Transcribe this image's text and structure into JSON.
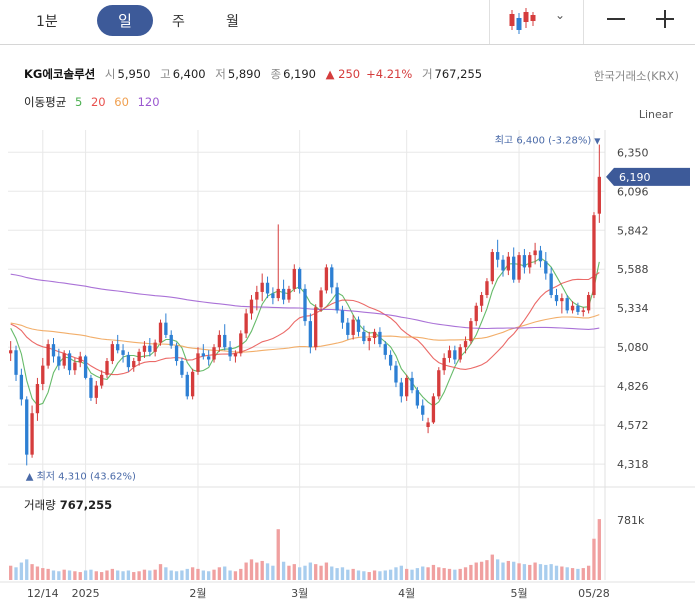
{
  "toolbar": {
    "timeframes": [
      "1분",
      "일",
      "주",
      "월"
    ],
    "active": "일",
    "icons": [
      "candlestick-chart-icon",
      "chevron-down-icon",
      "zoom-out-icon",
      "zoom-in-icon"
    ]
  },
  "stock": {
    "name": "KG에코솔루션",
    "open_label": "시",
    "open": "5,950",
    "high_label": "고",
    "high": "6,400",
    "low_label": "저",
    "low": "5,890",
    "close_label": "종",
    "close": "6,190",
    "change": "▲ 250",
    "change_pct": "+4.21%",
    "volume_label": "거",
    "volume": "767,255",
    "exchange": "한국거래소(KRX)"
  },
  "ma_legend": {
    "label": "이동평균",
    "periods": [
      {
        "text": "5",
        "color": "#4caf50"
      },
      {
        "text": "20",
        "color": "#e8504d"
      },
      {
        "text": "60",
        "color": "#f0a050"
      },
      {
        "text": "120",
        "color": "#9b59d0"
      }
    ]
  },
  "scale_mode": "Linear",
  "volume_panel": {
    "title": "거래량",
    "value": "767,255",
    "axis_label": "781k"
  },
  "colors": {
    "up": "#d53c3c",
    "down": "#2d7fd3",
    "volume_up": "#f0a0a0",
    "volume_down": "#a8cdee",
    "price_tag": "#3d5a99",
    "grid": "#e8e8e8"
  },
  "chart_data": {
    "type": "candlestick",
    "y_ticks": [
      "6,350",
      "6,096",
      "5,842",
      "5,588",
      "5,334",
      "5,080",
      "4,826",
      "4,572",
      "4,318"
    ],
    "x_ticks": [
      "12/14",
      "2025",
      "2월",
      "3월",
      "4월",
      "5월",
      "05/28"
    ],
    "ylim": [
      4280,
      6430
    ],
    "current_price": "6,190",
    "max_annotation": "최고 6,400 (-3.28%)",
    "min_annotation": "최저 4,310 (43.62%)",
    "candles": [
      [
        5040,
        5120,
        4990,
        5060
      ],
      [
        5060,
        5090,
        4860,
        4900
      ],
      [
        4900,
        4940,
        4700,
        4740
      ],
      [
        4740,
        4760,
        4310,
        4380
      ],
      [
        4380,
        4700,
        4360,
        4650
      ],
      [
        4650,
        4880,
        4600,
        4840
      ],
      [
        4840,
        5010,
        4800,
        4960
      ],
      [
        4960,
        5130,
        4940,
        5100
      ],
      [
        5100,
        5140,
        4980,
        5020
      ],
      [
        5020,
        5070,
        4930,
        4960
      ],
      [
        4960,
        5060,
        4940,
        5040
      ],
      [
        5040,
        5060,
        4900,
        4930
      ],
      [
        4930,
        5010,
        4900,
        4980
      ],
      [
        4980,
        5050,
        4950,
        5020
      ],
      [
        5020,
        5030,
        4870,
        4880
      ],
      [
        4880,
        4900,
        4730,
        4750
      ],
      [
        4750,
        4860,
        4710,
        4830
      ],
      [
        4830,
        4930,
        4810,
        4900
      ],
      [
        4900,
        5010,
        4880,
        4990
      ],
      [
        4990,
        5120,
        4970,
        5100
      ],
      [
        5100,
        5160,
        5040,
        5060
      ],
      [
        5060,
        5100,
        4980,
        5030
      ],
      [
        5030,
        5050,
        4920,
        4950
      ],
      [
        4950,
        5010,
        4920,
        4990
      ],
      [
        4990,
        5070,
        4960,
        5050
      ],
      [
        5050,
        5120,
        5010,
        5090
      ],
      [
        5090,
        5140,
        5020,
        5050
      ],
      [
        5050,
        5130,
        5020,
        5110
      ],
      [
        5110,
        5260,
        5090,
        5240
      ],
      [
        5240,
        5300,
        5140,
        5160
      ],
      [
        5160,
        5190,
        5070,
        5090
      ],
      [
        5090,
        5110,
        4960,
        4990
      ],
      [
        4990,
        5010,
        4880,
        4900
      ],
      [
        4900,
        4920,
        4740,
        4760
      ],
      [
        4760,
        4940,
        4740,
        4920
      ],
      [
        4920,
        5080,
        4900,
        5040
      ],
      [
        5040,
        5100,
        5000,
        5020
      ],
      [
        5020,
        5060,
        4960,
        5000
      ],
      [
        5000,
        5100,
        4980,
        5080
      ],
      [
        5080,
        5190,
        5050,
        5160
      ],
      [
        5160,
        5230,
        5060,
        5080
      ],
      [
        5080,
        5120,
        4990,
        5020
      ],
      [
        5020,
        5060,
        4980,
        5040
      ],
      [
        5040,
        5190,
        5020,
        5170
      ],
      [
        5170,
        5330,
        5140,
        5300
      ],
      [
        5300,
        5420,
        5260,
        5390
      ],
      [
        5390,
        5480,
        5320,
        5440
      ],
      [
        5440,
        5560,
        5380,
        5500
      ],
      [
        5500,
        5540,
        5400,
        5430
      ],
      [
        5430,
        5470,
        5360,
        5400
      ],
      [
        5400,
        5880,
        5380,
        5460
      ],
      [
        5460,
        5520,
        5360,
        5390
      ],
      [
        5390,
        5480,
        5370,
        5460
      ],
      [
        5460,
        5620,
        5440,
        5590
      ],
      [
        5590,
        5600,
        5430,
        5460
      ],
      [
        5460,
        5490,
        5220,
        5250
      ],
      [
        5250,
        5300,
        5040,
        5080
      ],
      [
        5080,
        5360,
        5060,
        5340
      ],
      [
        5340,
        5470,
        5310,
        5450
      ],
      [
        5450,
        5620,
        5430,
        5600
      ],
      [
        5600,
        5620,
        5430,
        5470
      ],
      [
        5470,
        5500,
        5300,
        5320
      ],
      [
        5320,
        5350,
        5200,
        5240
      ],
      [
        5240,
        5270,
        5130,
        5160
      ],
      [
        5160,
        5290,
        5130,
        5260
      ],
      [
        5260,
        5280,
        5150,
        5180
      ],
      [
        5180,
        5220,
        5100,
        5120
      ],
      [
        5120,
        5180,
        5060,
        5140
      ],
      [
        5140,
        5200,
        5100,
        5180
      ],
      [
        5180,
        5210,
        5080,
        5100
      ],
      [
        5100,
        5120,
        5000,
        5030
      ],
      [
        5030,
        5060,
        4930,
        4960
      ],
      [
        4960,
        4990,
        4820,
        4850
      ],
      [
        4850,
        4880,
        4720,
        4760
      ],
      [
        4760,
        4900,
        4730,
        4880
      ],
      [
        4880,
        4920,
        4780,
        4800
      ],
      [
        4800,
        4820,
        4680,
        4700
      ],
      [
        4700,
        4740,
        4600,
        4640
      ],
      [
        4560,
        4620,
        4520,
        4590
      ],
      [
        4590,
        4780,
        4580,
        4760
      ],
      [
        4760,
        4950,
        4740,
        4930
      ],
      [
        4930,
        5040,
        4900,
        5010
      ],
      [
        5010,
        5090,
        4980,
        5060
      ],
      [
        5060,
        5090,
        4970,
        5000
      ],
      [
        5000,
        5100,
        4980,
        5080
      ],
      [
        5080,
        5150,
        5040,
        5120
      ],
      [
        5120,
        5270,
        5100,
        5250
      ],
      [
        5250,
        5370,
        5220,
        5350
      ],
      [
        5350,
        5440,
        5310,
        5420
      ],
      [
        5420,
        5530,
        5400,
        5510
      ],
      [
        5510,
        5720,
        5490,
        5700
      ],
      [
        5700,
        5780,
        5600,
        5650
      ],
      [
        5650,
        5680,
        5540,
        5580
      ],
      [
        5580,
        5700,
        5550,
        5670
      ],
      [
        5670,
        5730,
        5500,
        5520
      ],
      [
        5520,
        5700,
        5500,
        5680
      ],
      [
        5680,
        5720,
        5560,
        5600
      ],
      [
        5600,
        5700,
        5560,
        5680
      ],
      [
        5680,
        5760,
        5620,
        5710
      ],
      [
        5710,
        5740,
        5600,
        5640
      ],
      [
        5640,
        5700,
        5520,
        5560
      ],
      [
        5560,
        5600,
        5400,
        5420
      ],
      [
        5420,
        5460,
        5350,
        5380
      ],
      [
        5380,
        5430,
        5300,
        5400
      ],
      [
        5400,
        5420,
        5300,
        5320
      ],
      [
        5320,
        5380,
        5300,
        5350
      ],
      [
        5350,
        5370,
        5290,
        5310
      ],
      [
        5310,
        5340,
        5280,
        5320
      ],
      [
        5320,
        5440,
        5300,
        5420
      ],
      [
        5420,
        5960,
        5400,
        5940
      ],
      [
        5950,
        6400,
        5890,
        6190
      ]
    ],
    "volume_max": 781000,
    "volumes": [
      180,
      160,
      220,
      260,
      200,
      170,
      150,
      140,
      120,
      110,
      130,
      120,
      110,
      100,
      120,
      130,
      110,
      100,
      120,
      140,
      120,
      110,
      120,
      100,
      110,
      130,
      120,
      130,
      200,
      160,
      120,
      110,
      120,
      140,
      160,
      140,
      120,
      110,
      130,
      160,
      170,
      120,
      110,
      140,
      220,
      260,
      220,
      240,
      210,
      180,
      640,
      230,
      180,
      200,
      160,
      180,
      220,
      200,
      180,
      220,
      170,
      150,
      160,
      130,
      140,
      120,
      110,
      100,
      120,
      110,
      120,
      130,
      160,
      180,
      140,
      130,
      150,
      170,
      160,
      190,
      160,
      150,
      140,
      130,
      140,
      160,
      190,
      220,
      230,
      250,
      320,
      260,
      220,
      240,
      230,
      210,
      200,
      190,
      220,
      200,
      190,
      200,
      180,
      170,
      160,
      150,
      140,
      150,
      180,
      520,
      767
    ]
  }
}
